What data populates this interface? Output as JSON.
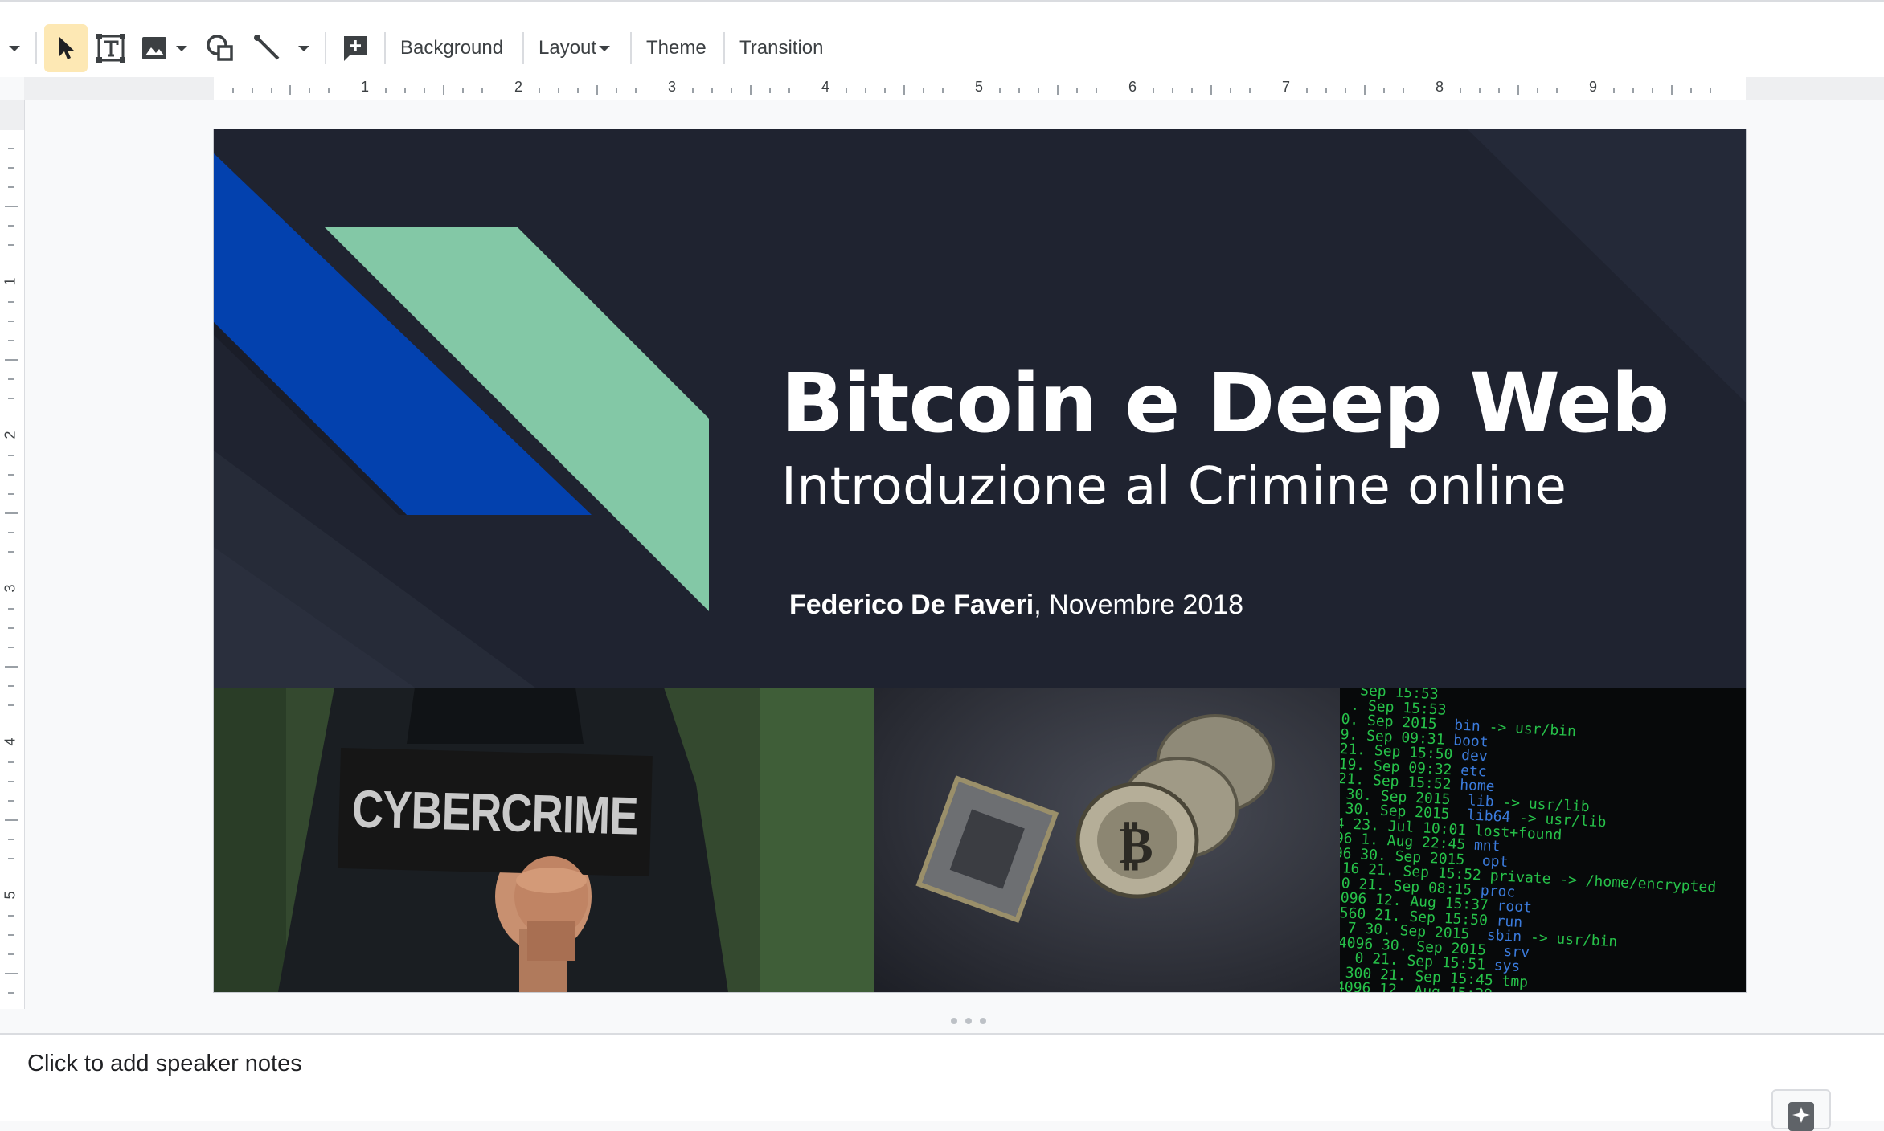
{
  "toolbar": {
    "background_label": "Background",
    "layout_label": "Layout",
    "theme_label": "Theme",
    "transition_label": "Transition",
    "icons": [
      "chevron-down-icon",
      "select-cursor-icon",
      "text-box-icon",
      "image-icon",
      "shape-icon",
      "line-icon",
      "add-comment-icon"
    ]
  },
  "ruler": {
    "horizontal": [
      "1",
      "2",
      "3",
      "4",
      "5",
      "6",
      "7",
      "8",
      "9"
    ],
    "vertical": [
      "1",
      "2",
      "3",
      "4",
      "5"
    ]
  },
  "slide": {
    "title": "Bitcoin e Deep Web",
    "subtitle": "Introduzione al Crimine online",
    "author": "Federico De Faveri",
    "date": ", Novembre 2018",
    "photo_sign": "CYBERCRIME",
    "colors": {
      "background": "#1f2330",
      "blue": "#0341ae",
      "green": "#83c8a6"
    }
  },
  "notes": {
    "placeholder": "Click to add speaker notes"
  }
}
